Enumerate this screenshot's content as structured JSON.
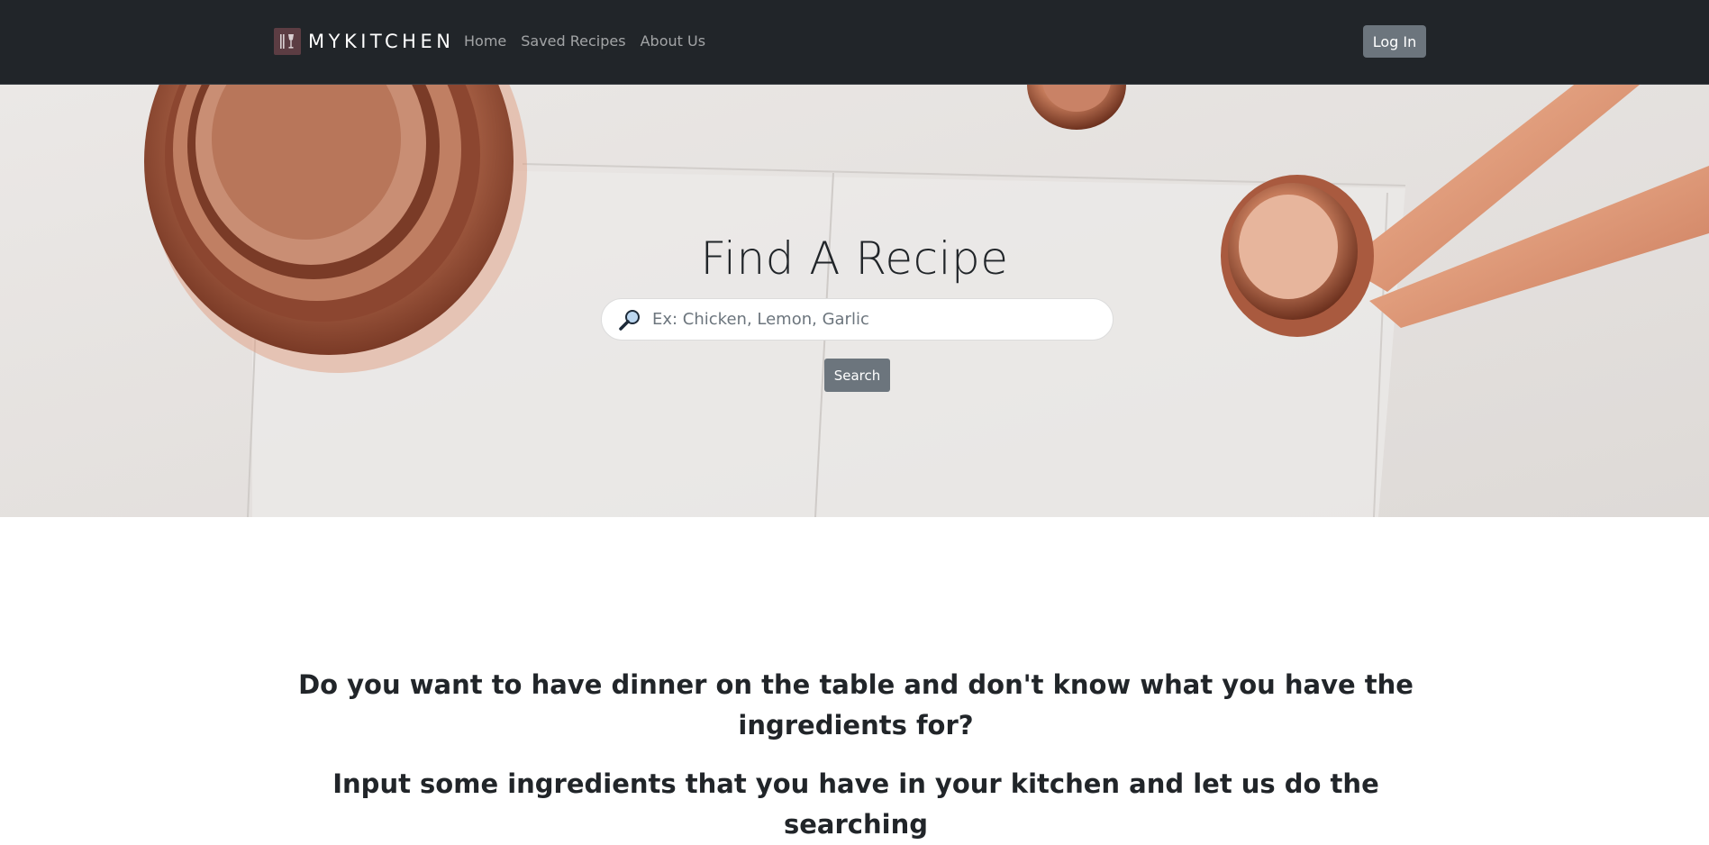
{
  "navbar": {
    "brand": "MYKITCHEN",
    "links": [
      "Home",
      "Saved Recipes",
      "About Us"
    ],
    "login_label": "Log In"
  },
  "hero": {
    "title": "Find A Recipe",
    "search_placeholder": "Ex: Chicken, Lemon, Garlic",
    "search_value": "",
    "search_button": "Search"
  },
  "content": {
    "heading_1": "Do you want to have dinner on the table and don't know what you have the ingredients for?",
    "heading_2": "Input some ingredients that you have in your kitchen and let us do the searching"
  },
  "icons": {
    "brand_logo": "utensils-glass-icon",
    "search": "magnifying-glass-icon"
  },
  "colors": {
    "navbar_bg": "#212529",
    "button_gray": "#6c757d",
    "copper": "#c47a5a"
  }
}
